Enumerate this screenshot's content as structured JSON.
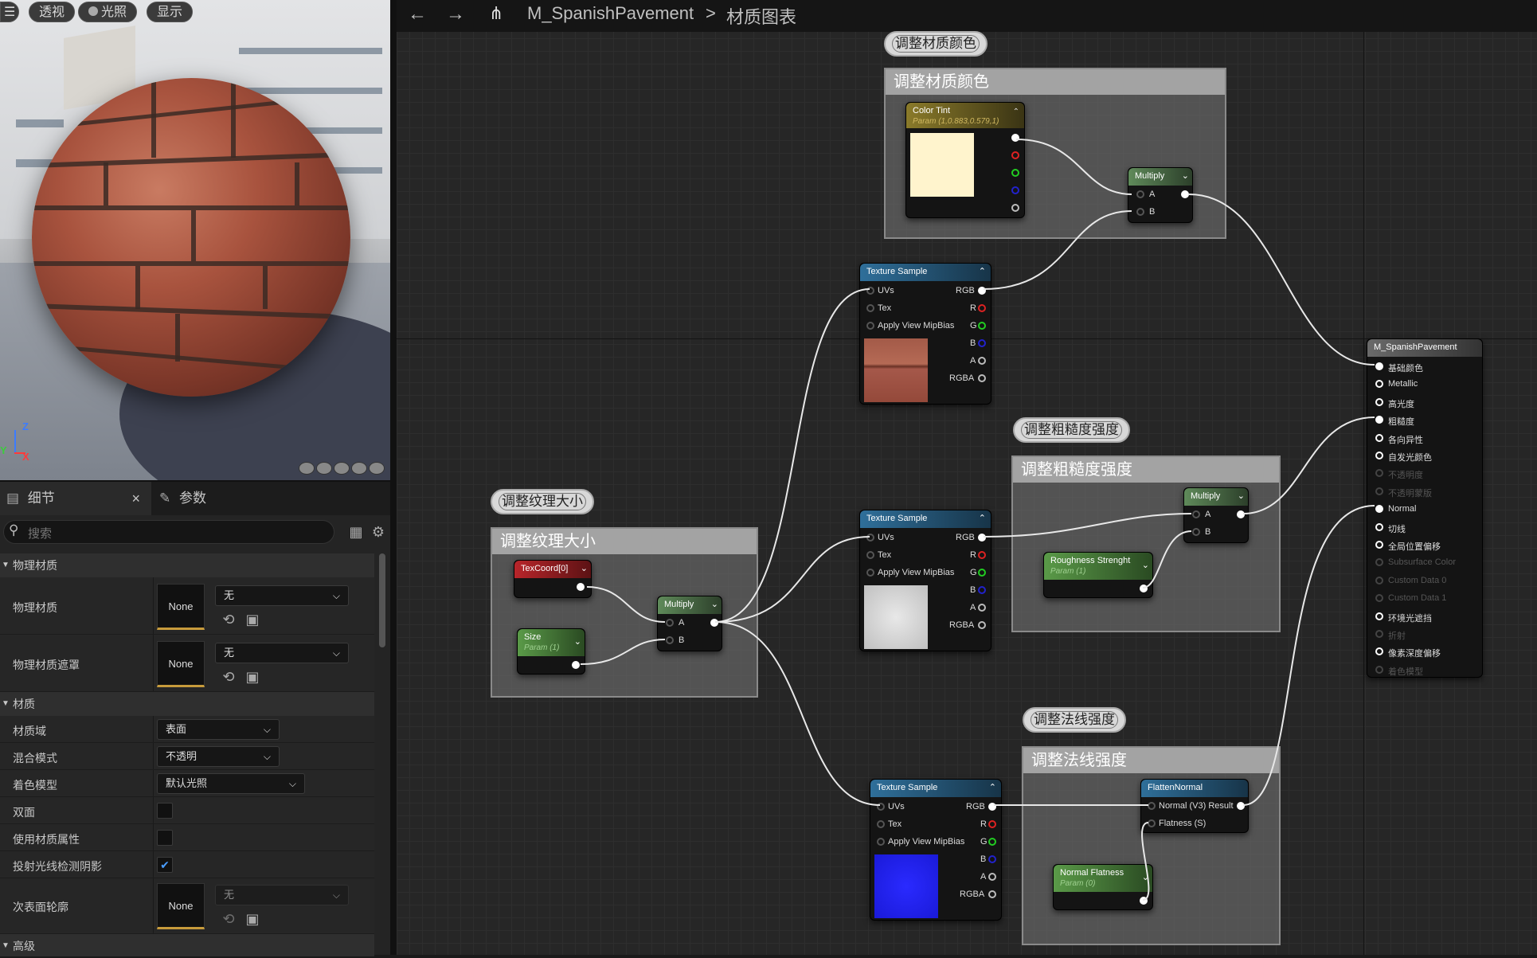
{
  "viewport": {
    "buttons": {
      "menu": "☰",
      "perspective": "透视",
      "lit": "光照",
      "show": "显示"
    },
    "axis": {
      "z": "Z",
      "x": "X",
      "y": "Y"
    }
  },
  "details": {
    "tabs": {
      "details": "细节",
      "params": "参数",
      "close": "×"
    },
    "search_placeholder": "搜索",
    "sections": {
      "physical": "物理材质",
      "material": "材质",
      "advanced": "高级"
    },
    "rows": {
      "phys_mat": {
        "label": "物理材质",
        "none": "None",
        "dropdown": "无"
      },
      "phys_mask": {
        "label": "物理材质遮罩",
        "none": "None",
        "dropdown": "无"
      },
      "domain": {
        "label": "材质域",
        "value": "表面"
      },
      "blend": {
        "label": "混合模式",
        "value": "不透明"
      },
      "shading": {
        "label": "着色模型",
        "value": "默认光照"
      },
      "two_sided": {
        "label": "双面"
      },
      "use_attrs": {
        "label": "使用材质属性"
      },
      "ray_shadow": {
        "label": "投射光线检测阴影"
      },
      "subsurface": {
        "label": "次表面轮廓",
        "none": "None",
        "dropdown": "无"
      }
    }
  },
  "graph": {
    "breadcrumb": {
      "asset": "M_SpanishPavement",
      "sep": ">",
      "page": "材质图表"
    },
    "comments": {
      "color": "调整材质颜色",
      "texsize": "调整纹理大小",
      "rough": "调整粗糙度强度",
      "normal": "调整法线强度"
    },
    "nodes": {
      "color_tint": {
        "title": "Color Tint",
        "sub": "Param (1,0.883,0.579,1)",
        "color": "#fff4cd"
      },
      "multiply": "Multiply",
      "pin_a": "A",
      "pin_b": "B",
      "texture_sample": "Texture Sample",
      "texsample_pins": {
        "uvs": "UVs",
        "tex": "Tex",
        "mip": "Apply View MipBias",
        "rgb": "RGB",
        "r": "R",
        "g": "G",
        "b": "B",
        "a": "A",
        "rgba": "RGBA"
      },
      "texcoord": "TexCoord[0]",
      "size": {
        "title": "Size",
        "sub": "Param (1)"
      },
      "roughness": {
        "title": "Roughness Strenght",
        "sub": "Param (1)"
      },
      "flatten": {
        "title": "FlattenNormal",
        "out": "Normal (V3) Result",
        "in": "Flatness (S)"
      },
      "normal_flat": {
        "title": "Normal Flatness",
        "sub": "Param (0)"
      },
      "result": {
        "title": "M_SpanishPavement",
        "pins": [
          "基础颜色",
          "Metallic",
          "高光度",
          "粗糙度",
          "各向异性",
          "自发光颜色",
          "不透明度",
          "不透明蒙版",
          "Normal",
          "切线",
          "全局位置偏移",
          "Subsurface Color",
          "Custom Data 0",
          "Custom Data 1",
          "环境光遮挡",
          "折射",
          "像素深度偏移",
          "着色模型"
        ]
      }
    }
  }
}
